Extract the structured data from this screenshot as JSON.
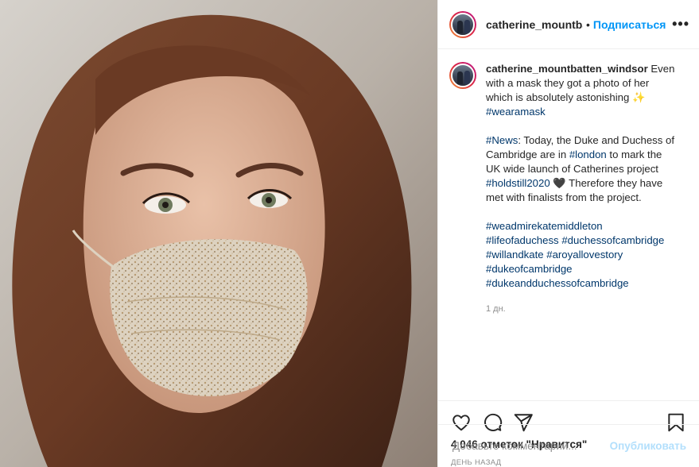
{
  "post": {
    "username": "catherine_mountbatten_windsor",
    "header_username": "catherine_mountba",
    "follow_label": "Подписаться",
    "more_label": "•••",
    "caption": {
      "line1": "Even with a mask they got a photo of her which is absolutely astonishing",
      "sparkle": "✨",
      "tag1": "#wearamask",
      "p2_tag": "#News",
      "p2_a": ": Today, the Duke and Duchess of Cambridge are in ",
      "p2_tag2": "#london",
      "p2_b": " to mark the UK wide launch of Catherines project ",
      "p2_tag3": "#holdstill2020",
      "p2_heart": "🖤",
      "p2_c": " Therefore they have met with finalists from the project.",
      "tags": [
        "#weadmirekatemiddleton",
        "#lifeofaduchess",
        "#duchessofcambridge",
        "#willandkate",
        "#aroyallovestory",
        "#dukeofcambridge",
        "#dukeandduchessofcambridge"
      ]
    },
    "caption_time": "1 дн.",
    "likes": "4 046 отметок \"Нравится\"",
    "date": "ДЕНЬ НАЗАД",
    "comment_placeholder": "Добавьте комментарий...",
    "publish_label": "Опубликовать"
  },
  "colors": {
    "link": "#00376b",
    "follow": "#0095f6",
    "publish_disabled": "#b2dffc",
    "muted": "#8e8e8e"
  },
  "icons": [
    "heart-icon",
    "comment-icon",
    "share-icon",
    "bookmark-icon"
  ]
}
